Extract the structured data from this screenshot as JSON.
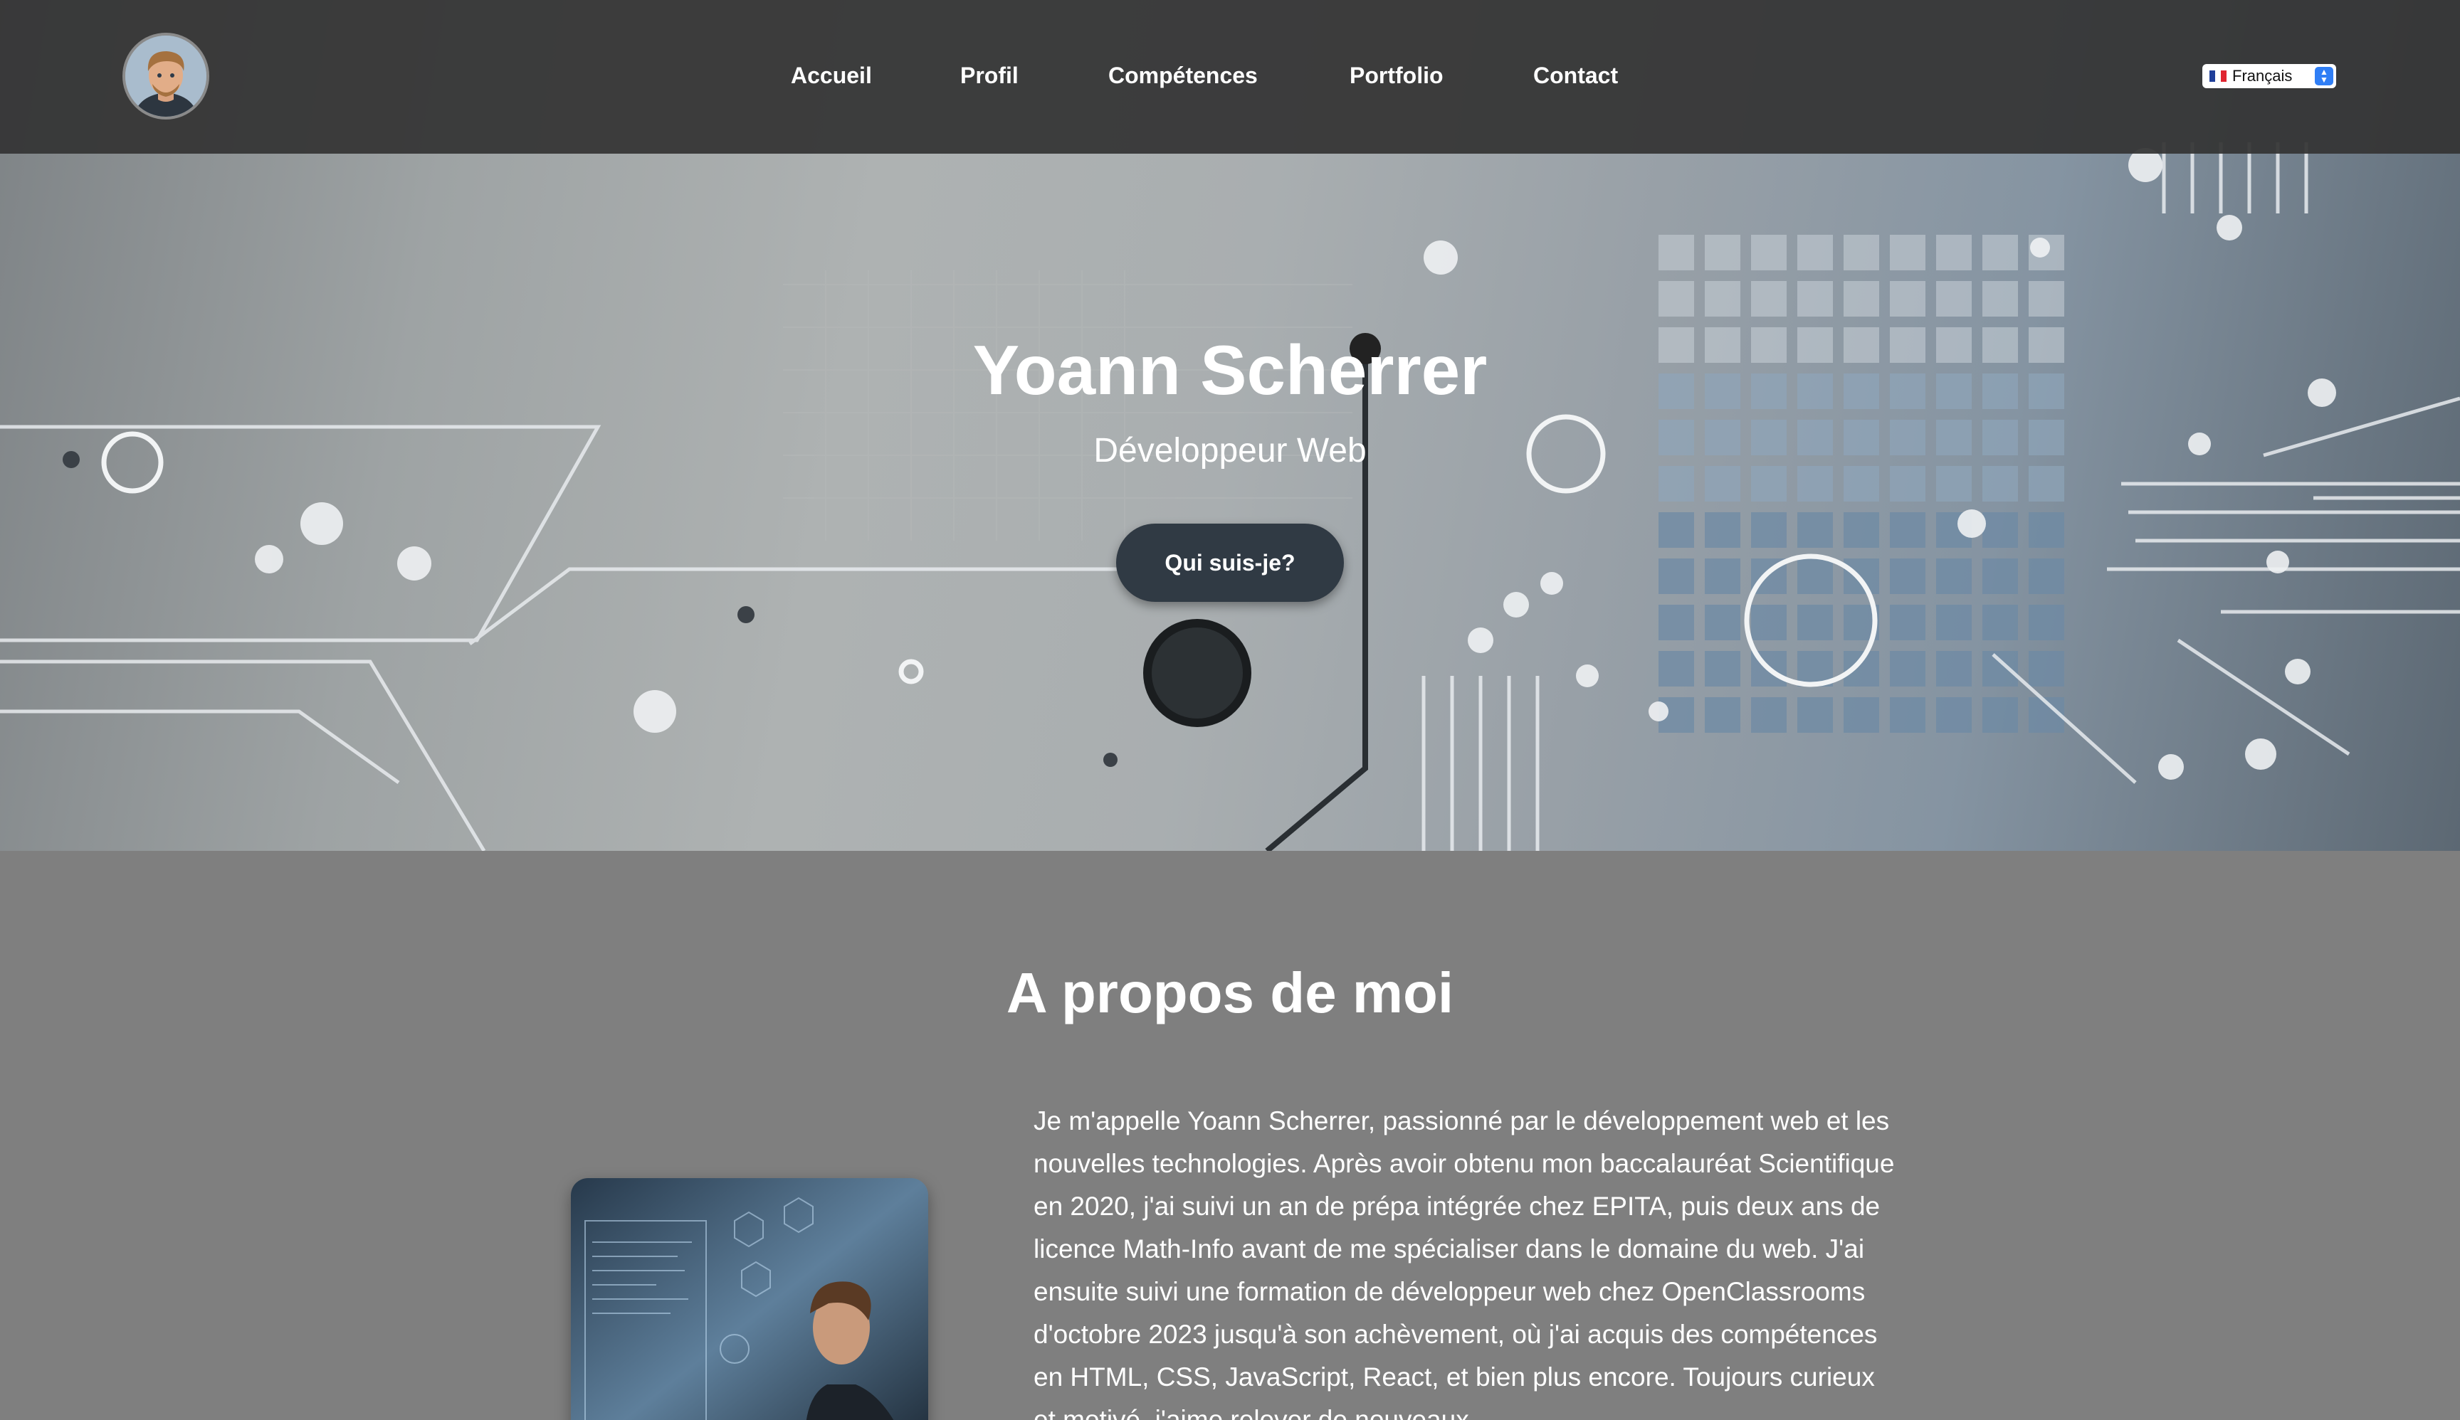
{
  "navbar": {
    "avatar_alt": "Avatar",
    "links": [
      "Accueil",
      "Profil",
      "Compétences",
      "Portfolio",
      "Contact"
    ],
    "language": {
      "selected": "Français",
      "flag": "fr-flag-icon"
    }
  },
  "hero": {
    "title": "Yoann Scherrer",
    "subtitle": "Développeur Web",
    "cta_label": "Qui suis-je?"
  },
  "about": {
    "title": "A propos de moi",
    "text": "Je m'appelle Yoann Scherrer, passionné par le développement web et les nouvelles technologies. Après avoir obtenu mon baccalauréat Scientifique en 2020, j'ai suivi un an de prépa intégrée chez EPITA, puis deux ans de licence Math-Info avant de me spécialiser dans le domaine du web. J'ai ensuite suivi une formation de développeur web chez OpenClassrooms d'octobre 2023 jusqu'à son achèvement, où j'ai acquis des compétences en HTML, CSS, JavaScript, React, et bien plus encore. Toujours curieux et motivé, j'aime relever de nouveaux"
  },
  "colors": {
    "navbar_bg": "#343434",
    "cta_bg": "#303a44",
    "section_bg": "#7f7f7f",
    "text": "#ffffff",
    "lang_accent": "#2f7ef5"
  }
}
